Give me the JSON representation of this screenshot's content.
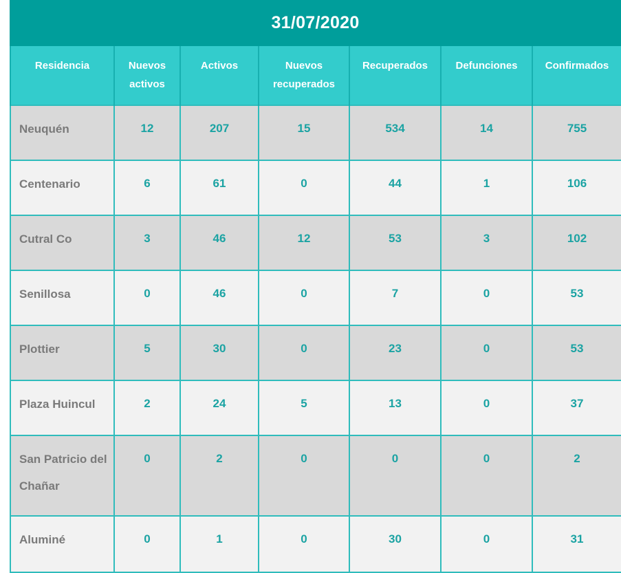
{
  "title": "31/07/2020",
  "columns": [
    "Residencia",
    "Nuevos activos",
    "Activos",
    "Nuevos recuperados",
    "Recuperados",
    "Defunciones",
    "Confirmados"
  ],
  "rows": [
    {
      "residencia": "Neuquén",
      "nuevos_activos": "12",
      "activos": "207",
      "nuevos_recuperados": "15",
      "recuperados": "534",
      "defunciones": "14",
      "confirmados": "755"
    },
    {
      "residencia": "Centenario",
      "nuevos_activos": "6",
      "activos": "61",
      "nuevos_recuperados": "0",
      "recuperados": "44",
      "defunciones": "1",
      "confirmados": "106"
    },
    {
      "residencia": "Cutral Co",
      "nuevos_activos": "3",
      "activos": "46",
      "nuevos_recuperados": "12",
      "recuperados": "53",
      "defunciones": "3",
      "confirmados": "102"
    },
    {
      "residencia": "Senillosa",
      "nuevos_activos": "0",
      "activos": "46",
      "nuevos_recuperados": "0",
      "recuperados": "7",
      "defunciones": "0",
      "confirmados": "53"
    },
    {
      "residencia": "Plottier",
      "nuevos_activos": "5",
      "activos": "30",
      "nuevos_recuperados": "0",
      "recuperados": "23",
      "defunciones": "0",
      "confirmados": "53"
    },
    {
      "residencia": "Plaza Huincul",
      "nuevos_activos": "2",
      "activos": "24",
      "nuevos_recuperados": "5",
      "recuperados": "13",
      "defunciones": "0",
      "confirmados": "37"
    },
    {
      "residencia": "San Patricio del Chañar",
      "nuevos_activos": "0",
      "activos": "2",
      "nuevos_recuperados": "0",
      "recuperados": "0",
      "defunciones": "0",
      "confirmados": "2"
    },
    {
      "residencia": "Aluminé",
      "nuevos_activos": "0",
      "activos": "1",
      "nuevos_recuperados": "0",
      "recuperados": "30",
      "defunciones": "0",
      "confirmados": "31"
    }
  ],
  "colors": {
    "title_bg": "#009e9b",
    "header_bg": "#33cccc",
    "row_odd": "#d9d9d9",
    "row_even": "#f2f2f2",
    "value_text": "#1ba3a3",
    "name_text": "#7a7a7a"
  }
}
